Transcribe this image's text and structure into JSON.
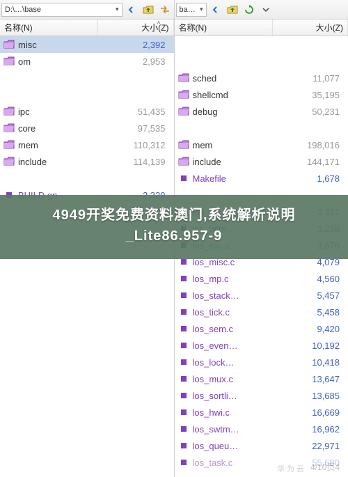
{
  "left": {
    "path": "D:\\…\\base",
    "headers": {
      "name": "名称(N)",
      "size": "大小(Z)",
      "sort_indicator": "^"
    },
    "rows": [
      {
        "type": "folder",
        "name": "misc",
        "size": "2,392",
        "selected": true
      },
      {
        "type": "folder",
        "name": "om",
        "size": "2,953",
        "gray": true
      },
      {
        "type": "spacer"
      },
      {
        "type": "spacer"
      },
      {
        "type": "folder",
        "name": "ipc",
        "size": "51,435",
        "gray": true
      },
      {
        "type": "folder",
        "name": "core",
        "size": "97,535",
        "gray": true
      },
      {
        "type": "folder",
        "name": "mem",
        "size": "110,312",
        "gray": true
      },
      {
        "type": "folder",
        "name": "include",
        "size": "114,139",
        "gray": true
      },
      {
        "type": "spacer"
      },
      {
        "type": "file",
        "name": "BUILD.gn",
        "size": "2,329",
        "purple": true
      }
    ]
  },
  "right": {
    "path": "ba…",
    "headers": {
      "name": "名称(N)",
      "size": "大小(Z)"
    },
    "rows": [
      {
        "type": "spacer"
      },
      {
        "type": "spacer"
      },
      {
        "type": "folder",
        "name": "sched",
        "size": "11,077",
        "gray": true
      },
      {
        "type": "folder",
        "name": "shellcmd",
        "size": "35,195",
        "gray": true
      },
      {
        "type": "folder",
        "name": "debug",
        "size": "50,231",
        "gray": true
      },
      {
        "type": "spacer"
      },
      {
        "type": "folder",
        "name": "mem",
        "size": "198,016",
        "gray": true
      },
      {
        "type": "folder",
        "name": "include",
        "size": "144,171",
        "gray": true
      },
      {
        "type": "file",
        "name": "Makefile",
        "size": "1,678",
        "purple": true
      },
      {
        "type": "spacer"
      },
      {
        "type": "file",
        "name": "los_err.c",
        "size": "3,117",
        "purple": true
      },
      {
        "type": "file",
        "name": "los_bitm…",
        "size": "3,238",
        "purple": true
      },
      {
        "type": "file",
        "name": "los_exc.c",
        "size": "3,676",
        "purple": true
      },
      {
        "type": "file",
        "name": "los_misc.c",
        "size": "4,079",
        "purple": true
      },
      {
        "type": "file",
        "name": "los_mp.c",
        "size": "4,560",
        "purple": true
      },
      {
        "type": "file",
        "name": "los_stack…",
        "size": "5,457",
        "purple": true
      },
      {
        "type": "file",
        "name": "los_tick.c",
        "size": "5,458",
        "purple": true
      },
      {
        "type": "file",
        "name": "los_sem.c",
        "size": "9,420",
        "purple": true
      },
      {
        "type": "file",
        "name": "los_even…",
        "size": "10,192",
        "purple": true
      },
      {
        "type": "file",
        "name": "los_lock…",
        "size": "10,418",
        "purple": true
      },
      {
        "type": "file",
        "name": "los_mux.c",
        "size": "13,647",
        "purple": true
      },
      {
        "type": "file",
        "name": "los_sortli…",
        "size": "13,685",
        "purple": true
      },
      {
        "type": "file",
        "name": "los_hwi.c",
        "size": "16,669",
        "purple": true
      },
      {
        "type": "file",
        "name": "los_swtm…",
        "size": "16,962",
        "purple": true
      },
      {
        "type": "file",
        "name": "los_queu…",
        "size": "22,971",
        "purple": true
      },
      {
        "type": "file",
        "name": "los_task.c",
        "size": "55,680",
        "purple": true,
        "dim": true
      }
    ]
  },
  "overlay": {
    "line1": "4949开奖免费资料澳门,系统解析说明",
    "line2": "_Lite86.957-9"
  },
  "watermark": "4/10页4",
  "watermark2": "华为云"
}
